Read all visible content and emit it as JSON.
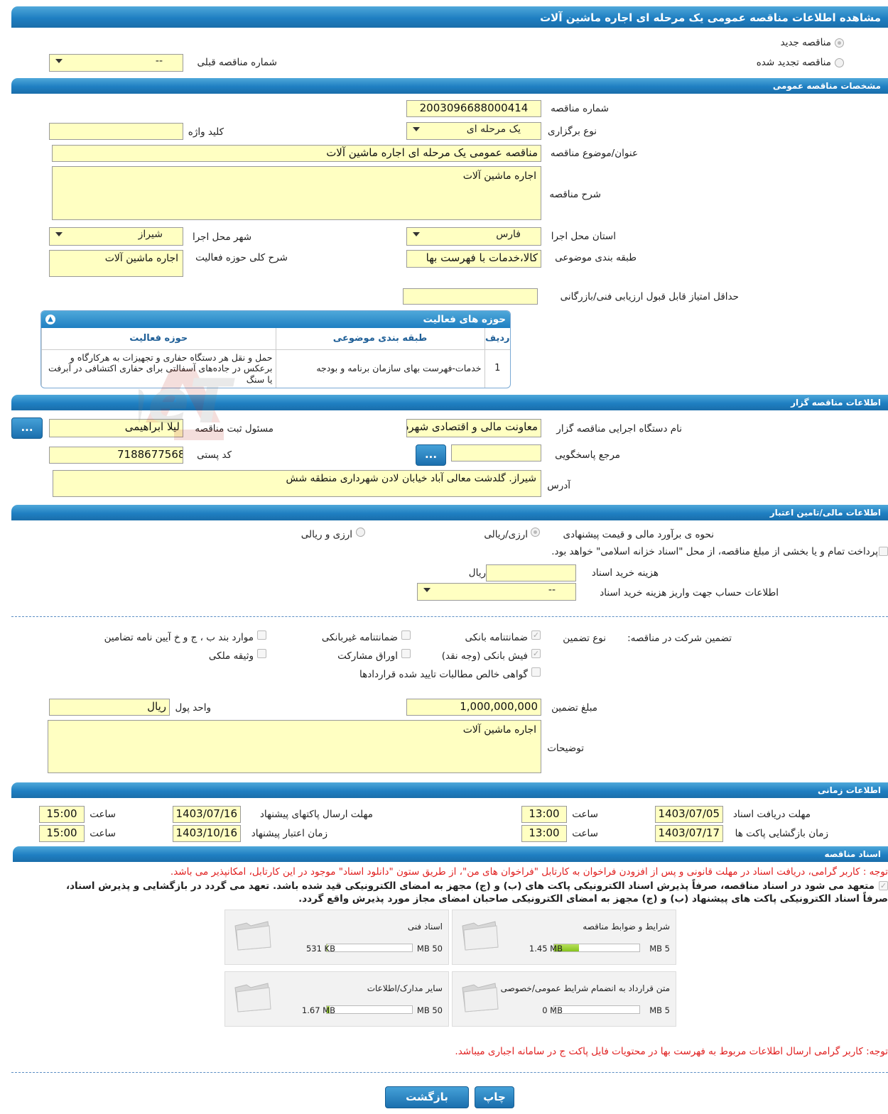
{
  "page": {
    "title": "مشاهده اطلاعات مناقصه عمومی یک مرحله ای اجاره ماشین آلات"
  },
  "top": {
    "radio_new": "مناقصه جدید",
    "radio_renewed": "مناقصه تجدید شده",
    "prev_number_label": "شماره مناقصه قبلی",
    "prev_number_value": "--"
  },
  "general": {
    "header": "مشخصات مناقصه عمومی",
    "number_label": "شماره مناقصه",
    "number_value": "2003096688000414",
    "keyword_label": "کلید واژه",
    "keyword_value": "",
    "type_label": "نوع برگزاری",
    "type_value": "یک مرحله ای",
    "subject_label": "عنوان/موضوع مناقصه",
    "subject_value": "مناقصه عمومی یک مرحله ای اجاره ماشین آلات",
    "desc_label": "شرح مناقصه",
    "desc_value": "اجاره ماشین آلات",
    "province_label": "استان محل اجرا",
    "province_value": "فارس",
    "city_label": "شهر محل اجرا",
    "city_value": "شیراز",
    "category_label": "طبقه بندی موضوعی",
    "category_value": "کالا،خدمات با فهرست بها",
    "activity_desc_label": "شرح کلی حوزه فعالیت",
    "activity_desc_value": "اجاره ماشین آلات",
    "min_score_label": "حداقل امتیاز قابل قبول ارزیابی فنی/بازرگانی",
    "min_score_value": ""
  },
  "activity": {
    "header": "حوزه های فعالیت",
    "columns": [
      "ردیف",
      "طبقه بندی موضوعی",
      "حوزه فعالیت"
    ],
    "rows": [
      {
        "idx": "1",
        "category": "خدمات-فهرست بهای سازمان برنامه و بودجه",
        "field": "حمل و نقل هر دستگاه حفاری و تجهیزات به هرکارگاه و برعکس در جاده‌های آسفالتی برای حفاری اکتشافی در آبرفت یا سنگ"
      }
    ]
  },
  "organizer": {
    "header": "اطلاعات مناقصه گزار",
    "org_label": "نام دستگاه اجرایی مناقصه گزار",
    "org_value": "معاونت مالی و اقتصادی شهرداری شیراز",
    "responsible_label": "مسئول ثبت مناقصه",
    "responsible_value": "لیلا ابراهیمی",
    "ref_label": "مرجع پاسخگویی",
    "ref_value": "",
    "postal_label": "کد پستی",
    "postal_value": "7188677568",
    "address_label": "آدرس",
    "address_value": "شیراز. گلدشت معالی آباد خیابان لادن شهرداری منطقه شش",
    "more_btn": "..."
  },
  "finance": {
    "header": "اطلاعات مالی/تامین اعتبار",
    "method_label": "نحوه ی برآورد مالی و قیمت پیشنهادی",
    "opt1": "ارزی/ریالی",
    "opt2": "ارزی و ریالی",
    "treasury": "پرداخت تمام و یا بخشی از مبلغ مناقصه، از محل \"اسناد خزانه اسلامی\" خواهد بود.",
    "doc_cost_label": "هزینه خرید اسناد",
    "doc_cost_value": "",
    "doc_cost_unit": "ریال",
    "account_label": "اطلاعات حساب جهت واریز هزینه خرید اسناد",
    "account_value": "--"
  },
  "guarantee": {
    "label": "تضمین شرکت در مناقصه:",
    "type_label": "نوع تضمین",
    "opt_bank": "ضمانتنامه بانکی",
    "opt_nonbank": "ضمانتنامه غیربانکی",
    "opt_rules": "موارد بند ب ، ج و خ آیین نامه تضامین",
    "opt_cash": "فیش بانکی (وجه نقد)",
    "opt_bonds": "اوراق مشارکت",
    "opt_property": "وثیقه ملکی",
    "opt_cert": "گواهی خالص مطالبات تایید شده قراردادها",
    "amount_label": "مبلغ تضمین",
    "amount_value": "1,000,000,000",
    "currency_label": "واحد پول",
    "currency_value": "ریال",
    "notes_label": "توضیحات",
    "notes_value": "اجاره ماشین آلات"
  },
  "timing": {
    "header": "اطلاعات زمانی",
    "doc_deadline_label": "مهلت دریافت اسناد",
    "doc_deadline_date": "1403/07/05",
    "doc_deadline_time": "13:00",
    "send_deadline_label": "مهلت ارسال پاکتهای پیشنهاد",
    "send_deadline_date": "1403/07/16",
    "send_deadline_time": "15:00",
    "open_label": "زمان بازگشایی پاکت ها",
    "open_date": "1403/07/17",
    "open_time": "13:00",
    "validity_label": "زمان اعتبار پیشنهاد",
    "validity_date": "1403/10/16",
    "validity_time": "15:00",
    "time_label": "ساعت"
  },
  "docs": {
    "header": "اسناد مناقصه",
    "notice": "توجه : کاربر گرامی، دریافت اسناد در مهلت قانونی و پس از افزودن فراخوان به کارتابل \"فراخوان های من\"، از طریق ستون \"دانلود اسناد\" موجود در این کارتابل، امکانپذیر می باشد.",
    "commit1": "متعهد می شود در اسناد مناقصه، صرفاً پذیرش اسناد الکترونیکی پاکت های (ب) و (ج) مجهز به امضای الکترونیکی قید شده باشد. تعهد می گردد در بازگشایی و پذیرش اسناد،",
    "commit2": "صرفاً اسناد الکترونیکی پاکت های پیشنهاد (ب) و (ج) مجهز به امضای الکترونیکی صاحبان امضای مجاز مورد پذیرش واقع گردد.",
    "tiles": [
      {
        "name": "شرایط و ضوابط مناقصه",
        "used": "1.45 MB",
        "max": "5 MB",
        "fraction": 0.29
      },
      {
        "name": "اسناد فنی",
        "used": "531 KB",
        "max": "50 MB",
        "fraction": 0.01
      },
      {
        "name": "متن قرارداد به انضمام شرایط عمومی/خصوصی",
        "used": "0 MB",
        "max": "5 MB",
        "fraction": 0.0
      },
      {
        "name": "سایر مدارک/اطلاعات",
        "used": "1.67 MB",
        "max": "50 MB",
        "fraction": 0.033
      }
    ],
    "footnote": "توجه: کاربر گرامی ارسال اطلاعات مربوط به فهرست بها در محتویات فایل پاکت ج در سامانه اجباری میباشد."
  },
  "watermark": "AriaTender.neT",
  "buttons": {
    "print": "چاپ",
    "back": "بازگشت"
  }
}
